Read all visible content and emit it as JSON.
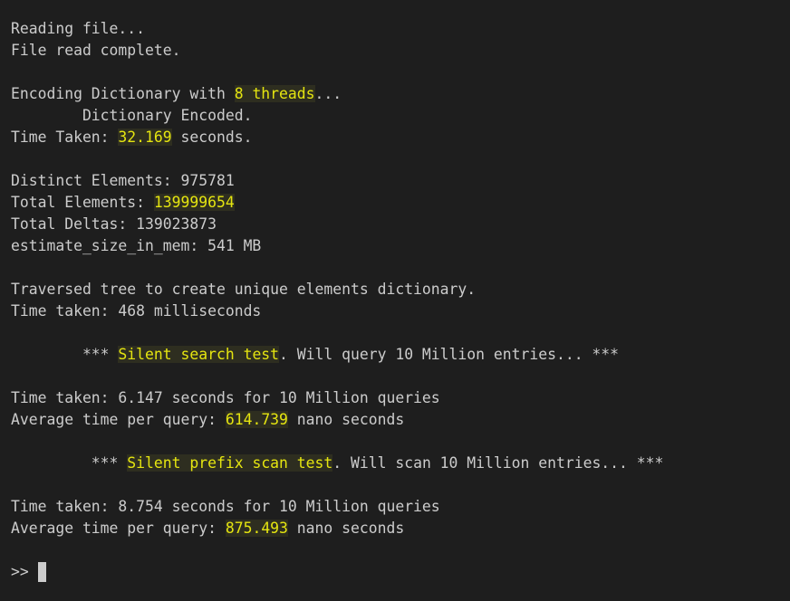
{
  "terminal": {
    "line1": "Reading file...",
    "line2": "File read complete.",
    "encoding": {
      "pre": "Encoding Dictionary with ",
      "threads": "8 threads",
      "post": "..."
    },
    "dict_encoded": "        Dictionary Encoded.",
    "time_taken_1": {
      "pre": "Time Taken: ",
      "value": "32.169",
      "post": " seconds."
    },
    "distinct": "Distinct Elements: 975781",
    "total_elements": {
      "pre": "Total Elements: ",
      "value": "139999654"
    },
    "total_deltas": "Total Deltas: 139023873",
    "estimate_size": "estimate_size_in_mem: 541 MB",
    "traversed": "Traversed tree to create unique elements dictionary.",
    "time_taken_2": "Time taken: 468 milliseconds",
    "search_test": {
      "pre": "        *** ",
      "value": "Silent search test",
      "post": ". Will query 10 Million entries... ***"
    },
    "search_time": "Time taken: 6.147 seconds for 10 Million queries",
    "search_avg": {
      "pre": "Average time per query: ",
      "value": "614.739",
      "post": " nano seconds"
    },
    "prefix_test": {
      "pre": "         *** ",
      "value": "Silent prefix scan test",
      "post": ". Will scan 10 Million entries... ***"
    },
    "prefix_time": "Time taken: 8.754 seconds for 10 Million queries",
    "prefix_avg": {
      "pre": "Average time per query: ",
      "value": "875.493",
      "post": " nano seconds"
    },
    "prompt": ">> "
  },
  "colors": {
    "background": "#1e1e1e",
    "text": "#cccccc",
    "highlight": "#e5e510"
  }
}
